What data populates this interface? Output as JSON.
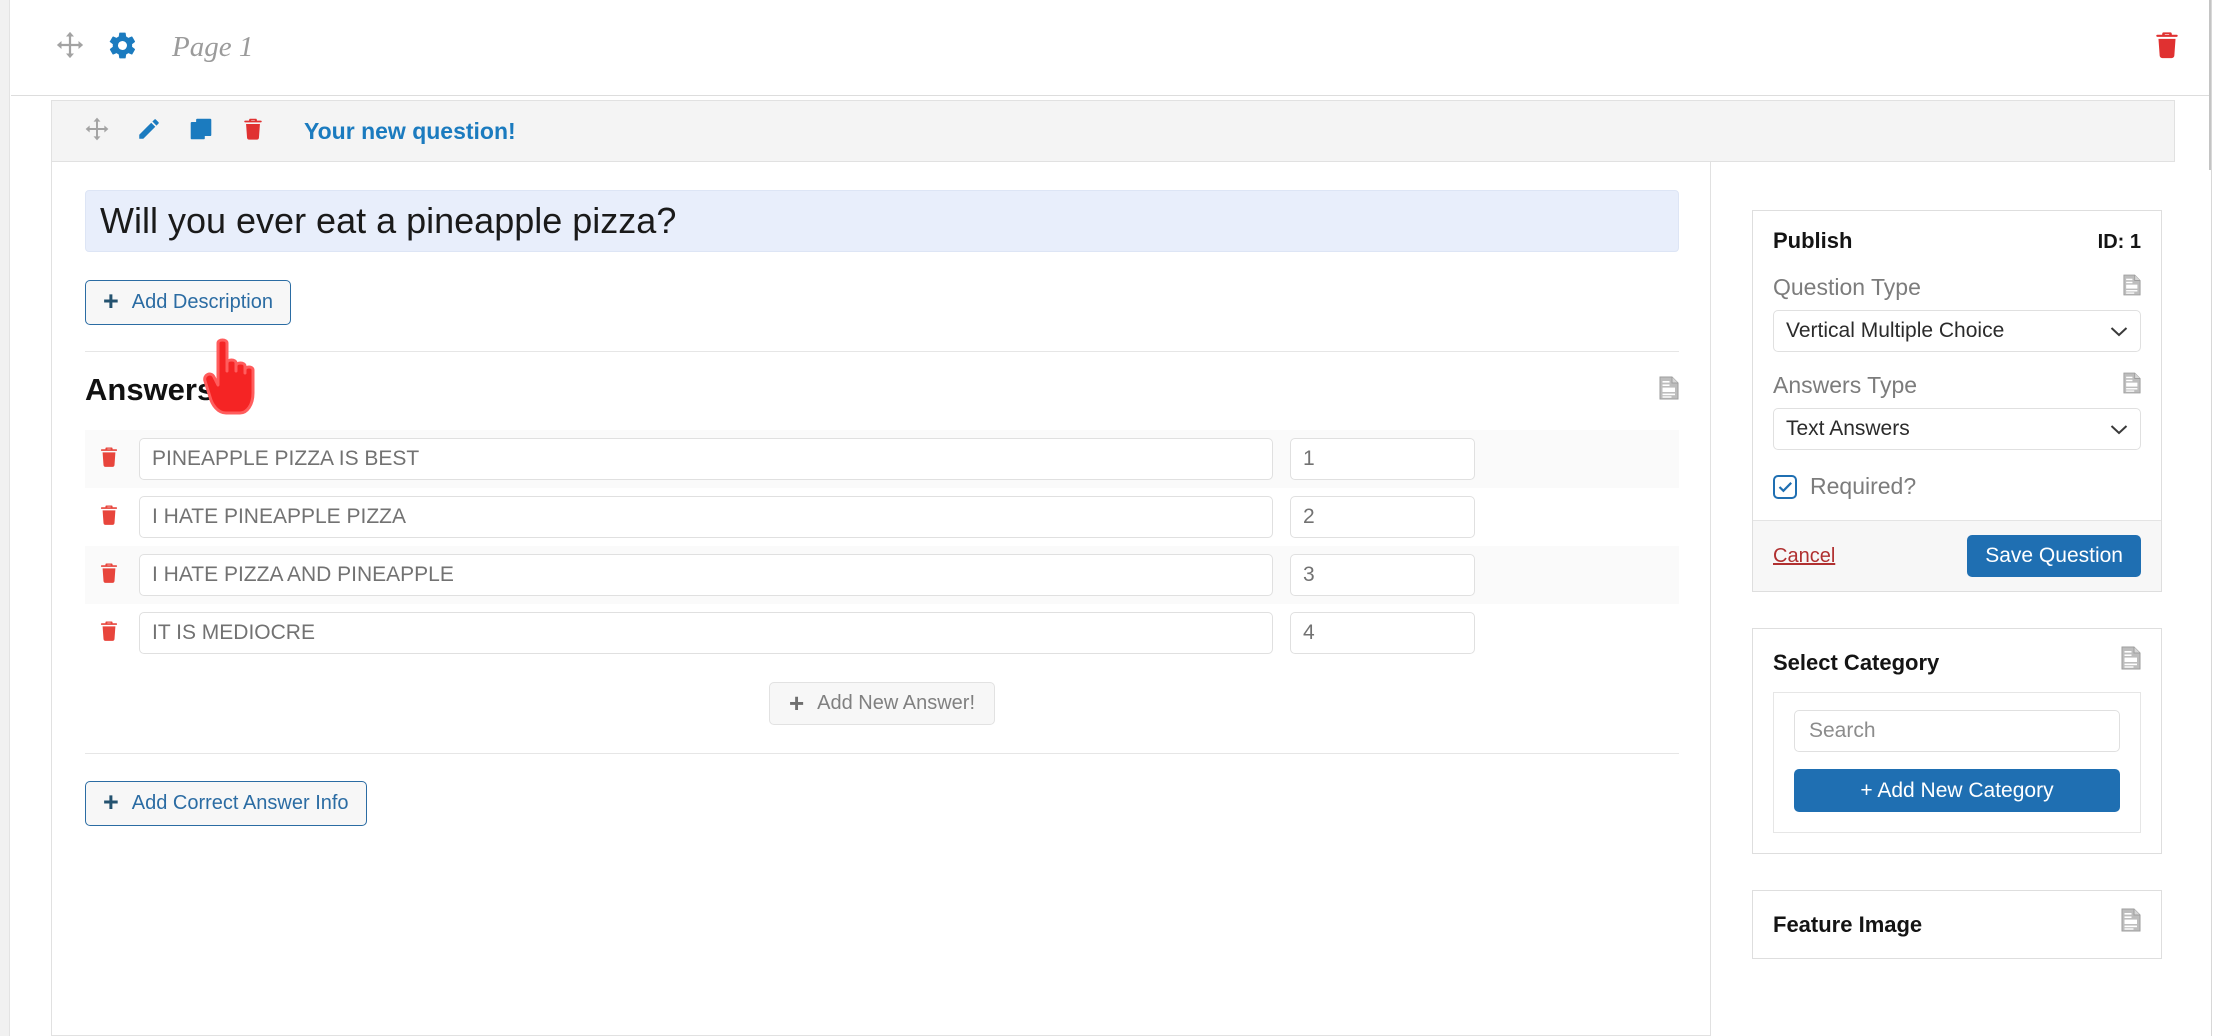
{
  "header": {
    "move_icon": "move-icon",
    "gear_icon": "gear-icon",
    "title": "Page 1",
    "delete_icon": "trash-icon"
  },
  "question_toolbar": {
    "move_icon": "move-icon",
    "edit_icon": "pencil-icon",
    "duplicate_icon": "copy-icon",
    "delete_icon": "trash-icon",
    "title": "Your new question!"
  },
  "editor": {
    "question_text": "Will you ever eat a pineapple pizza?",
    "question_placeholder": "Your new question!",
    "add_description_label": "Add Description",
    "answers_heading": "Answers",
    "answers_help_icon": "document-icon",
    "answers": [
      {
        "text": "PINEAPPLE PIZZA IS BEST",
        "order": "1",
        "delete_icon": "trash-icon"
      },
      {
        "text": "I HATE PINEAPPLE PIZZA",
        "order": "2",
        "delete_icon": "trash-icon"
      },
      {
        "text": "I HATE PIZZA AND PINEAPPLE",
        "order": "3",
        "delete_icon": "trash-icon"
      },
      {
        "text": "IT IS MEDIOCRE",
        "order": "4",
        "delete_icon": "trash-icon"
      }
    ],
    "add_new_answer_label": "Add New Answer!",
    "add_correct_answer_label": "Add Correct Answer Info"
  },
  "sidebar": {
    "publish": {
      "title": "Publish",
      "id_label": "ID: 1",
      "question_type_label": "Question Type",
      "question_type_help_icon": "document-icon",
      "question_type_value": "Vertical Multiple Choice",
      "answers_type_label": "Answers Type",
      "answers_type_help_icon": "document-icon",
      "answers_type_value": "Text Answers",
      "required_label": "Required?",
      "required_checked": true,
      "cancel_label": "Cancel",
      "save_label": "Save Question"
    },
    "category": {
      "title": "Select Category",
      "help_icon": "document-icon",
      "search_placeholder": "Search",
      "search_value": "Search",
      "add_new_label": "+ Add New Category"
    },
    "feature_image": {
      "title": "Feature Image",
      "help_icon": "document-icon"
    }
  },
  "colors": {
    "accent_blue": "#1f6fb2",
    "link_blue": "#1b7bbf",
    "danger_red": "#e03131",
    "cancel_red": "#b03030",
    "question_field_bg": "#e8eefb",
    "cursor_red": "#f52424"
  },
  "cursor": {
    "icon": "pointing-hand-cursor"
  }
}
